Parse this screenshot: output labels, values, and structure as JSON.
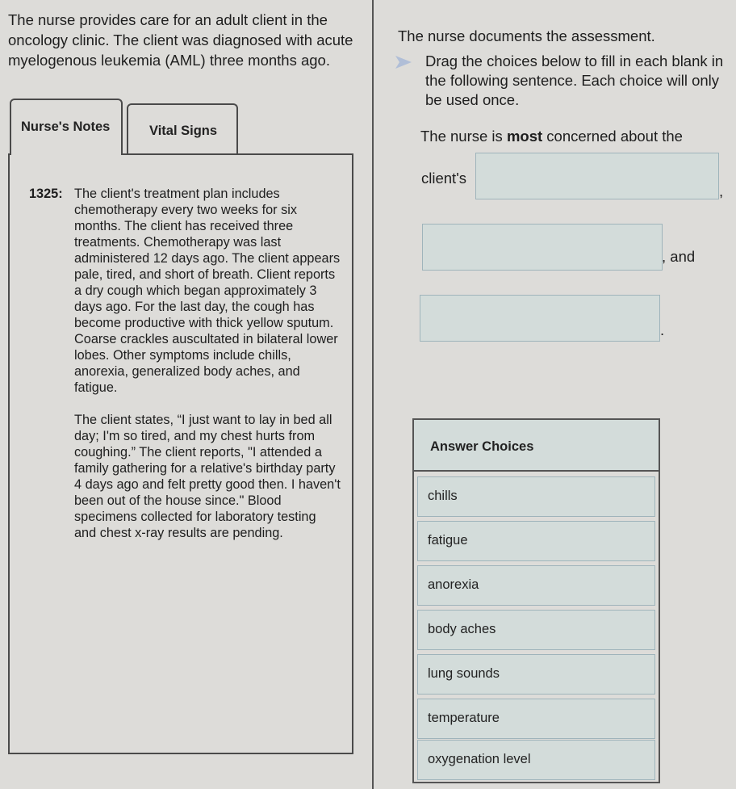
{
  "scenario": "The nurse provides care for an adult client in the oncology clinic. The client was diagnosed with acute myelogenous leukemia (AML) three months ago.",
  "tabs": [
    {
      "label": "Nurse's Notes",
      "active": true
    },
    {
      "label": "Vital Signs",
      "active": false
    }
  ],
  "notes": {
    "time": "1325:",
    "paragraphs": [
      "The client's treatment plan includes chemotherapy every two weeks for six months. The client has received three treatments. Chemotherapy was last administered 12 days ago. The client appears pale, tired, and short of breath. Client reports a dry cough which began approximately 3 days ago. For the last day, the cough has become productive with thick yellow sputum. Coarse crackles auscultated in bilateral lower lobes. Other symptoms include chills, anorexia, generalized body aches, and fatigue.",
      "The client states, “I just want to lay in bed all day; I'm so tired, and my chest hurts from coughing.” The client reports, \"I attended a family gathering for a relative's birthday party 4 days ago and felt pretty good then. I haven't been out of the house since.\" Blood specimens collected for laboratory testing and chest x-ray results are pending."
    ]
  },
  "question": {
    "doc_line": "The nurse documents the assessment.",
    "instruction": "Drag the choices below to fill in each blank in the following sentence. Each choice will only be used once.",
    "instruction_icon": "drag-arrow-icon",
    "sentence_prefix": "The nurse is ",
    "sentence_bold": "most",
    "sentence_suffix": " concerned about the",
    "blank1_prefix": "client's",
    "blank1_suffix": ",",
    "blank2_suffix": ", and",
    "blank3_suffix": ".",
    "blanks": [
      "",
      "",
      ""
    ]
  },
  "answer_choices": {
    "header": "Answer Choices",
    "items": [
      "chills",
      "fatigue",
      "anorexia",
      "body aches",
      "lung sounds",
      "temperature",
      "oxygenation level"
    ]
  },
  "colors": {
    "background": "#dddcd9",
    "blank_fill": "#d3dcda",
    "blank_border": "#9fb4bb",
    "arrow_accent": "#8aa6d6"
  }
}
